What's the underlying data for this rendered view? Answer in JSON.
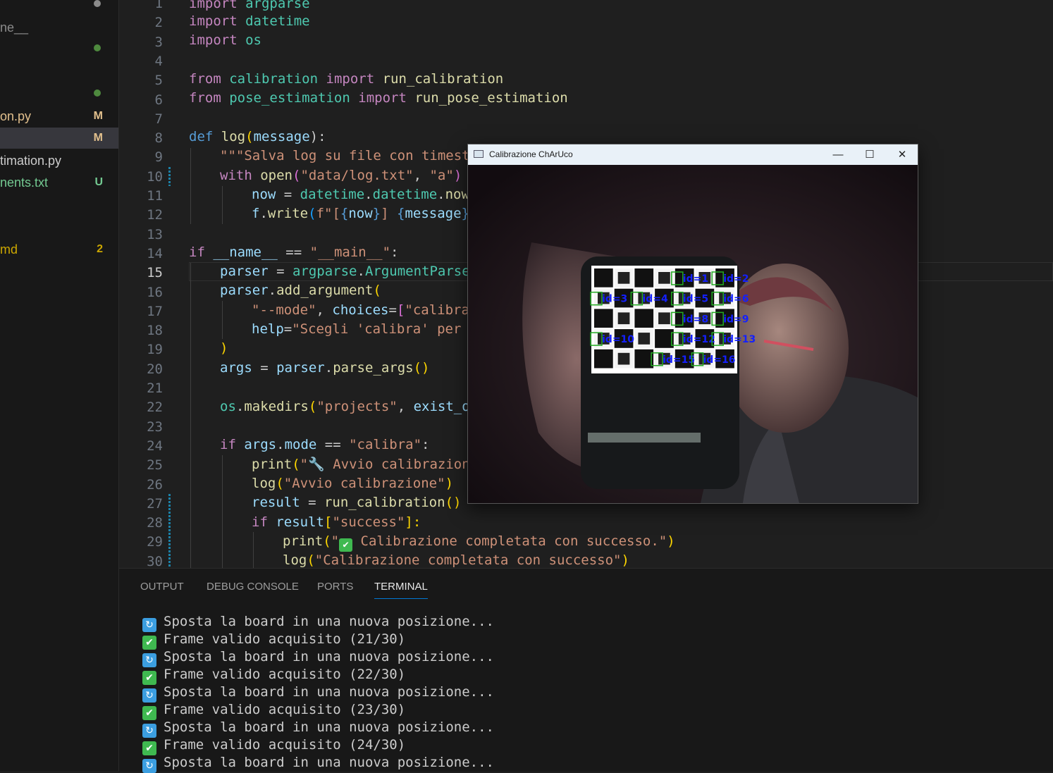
{
  "sidebar": {
    "items": [
      {
        "name": "",
        "status": "dot",
        "color": "#8b8b8b"
      },
      {
        "name": "ne__",
        "status": "",
        "color": "#8b8b8b"
      },
      {
        "name": "",
        "status": "dot",
        "color": "#4e8a3e"
      },
      {
        "name": "",
        "status": "dot",
        "color": "#4e8a3e"
      },
      {
        "name": "on.py",
        "status": "M",
        "color": "#e2c08d"
      },
      {
        "name": "",
        "status": "M",
        "color": "#e2c08d"
      },
      {
        "name": "timation.py",
        "status": "",
        "color": "#cccccc"
      },
      {
        "name": "nents.txt",
        "status": "U",
        "color": "#73c991"
      },
      {
        "name": "md",
        "status": "2",
        "color": "#cca700"
      }
    ]
  },
  "editor": {
    "current_line": 15,
    "line_numbers": [
      "1",
      "2",
      "3",
      "4",
      "5",
      "6",
      "7",
      "8",
      "9",
      "10",
      "11",
      "12",
      "13",
      "14",
      "15",
      "16",
      "17",
      "18",
      "19",
      "20",
      "21",
      "22",
      "23",
      "24",
      "25",
      "26",
      "27",
      "28",
      "29",
      "30"
    ]
  },
  "code": {
    "l1": [
      "import",
      "argparse"
    ],
    "l2": [
      "import",
      "datetime"
    ],
    "l3": [
      "import",
      "os"
    ],
    "l5": [
      "from",
      "calibration",
      "import",
      "run_calibration"
    ],
    "l6": [
      "from",
      "pose_estimation",
      "import",
      "run_pose_estimation"
    ],
    "l8": [
      "def",
      "log",
      "(",
      "message",
      "):"
    ],
    "l9": "\"\"\"Salva log su file con timesta",
    "l10": [
      "with",
      "open",
      "(",
      "\"data/log.txt\"",
      ", ",
      "\"a\"",
      ")",
      " a"
    ],
    "l11": [
      "now",
      " = ",
      "datetime",
      ".",
      "datetime",
      ".",
      "now",
      "("
    ],
    "l12": [
      "f",
      ".",
      "write",
      "(",
      "f\"[",
      "{",
      "now",
      "}",
      "] ",
      "{",
      "message",
      "}",
      "\\"
    ],
    "l14": [
      "if",
      "__name__",
      " == ",
      "\"__main__\"",
      ":"
    ],
    "l15": [
      "parser",
      " = ",
      "argparse",
      ".",
      "ArgumentParser"
    ],
    "l16": [
      "parser",
      ".",
      "add_argument",
      "("
    ],
    "l17": [
      "\"--mode\"",
      ", ",
      "choices",
      "=",
      "[",
      "\"calibra\""
    ],
    "l18": [
      "help",
      "=",
      "\"Scegli 'calibra' per c"
    ],
    "l19": ")",
    "l20": [
      "args",
      " = ",
      "parser",
      ".",
      "parse_args",
      "()"
    ],
    "l22": [
      "os",
      ".",
      "makedirs",
      "(",
      "\"projects\"",
      ", ",
      "exist_ok"
    ],
    "l24": [
      "if",
      "args",
      ".",
      "mode",
      " == ",
      "\"calibra\"",
      ":"
    ],
    "l25": [
      "print",
      "(",
      "\"🔧 Avvio calibrazion"
    ],
    "l26": [
      "log",
      "(",
      "\"Avvio calibrazione\"",
      ")"
    ],
    "l27": [
      "result",
      " = ",
      "run_calibration",
      "()"
    ],
    "l28": [
      "if",
      "result",
      "[",
      "\"success\"",
      "]:"
    ],
    "l29": [
      "print",
      "(",
      "\"",
      "✔",
      " Calibrazione completata con successo.\"",
      ")"
    ],
    "l30": [
      "log",
      "(",
      "\"Calibrazione completata con successo\"",
      ")"
    ]
  },
  "panel": {
    "tabs": [
      "OUTPUT",
      "DEBUG CONSOLE",
      "PORTS",
      "TERMINAL"
    ],
    "active_tab": "TERMINAL",
    "terminal_lines": [
      {
        "icon": "cycle-icon",
        "text": "Sposta la board in una nuova posizione..."
      },
      {
        "icon": "check-icon",
        "text": "Frame valido acquisito (21/30)"
      },
      {
        "icon": "cycle-icon",
        "text": "Sposta la board in una nuova posizione..."
      },
      {
        "icon": "check-icon",
        "text": "Frame valido acquisito (22/30)"
      },
      {
        "icon": "cycle-icon",
        "text": "Sposta la board in una nuova posizione..."
      },
      {
        "icon": "check-icon",
        "text": "Frame valido acquisito (23/30)"
      },
      {
        "icon": "cycle-icon",
        "text": "Sposta la board in una nuova posizione..."
      },
      {
        "icon": "check-icon",
        "text": "Frame valido acquisito (24/30)"
      },
      {
        "icon": "cycle-icon",
        "text": "Sposta la board in una nuova posizione..."
      }
    ]
  },
  "window": {
    "title": "Calibrazione ChArUco",
    "minimize_glyph": "—",
    "maximize_glyph": "☐",
    "close_glyph": "✕",
    "marker_labels": [
      "id=1",
      "id=2",
      "id=3",
      "id=4",
      "id=5",
      "id=6",
      "id=8",
      "id=9",
      "id=10",
      "id=12",
      "id=13",
      "id=15",
      "id=16"
    ]
  }
}
